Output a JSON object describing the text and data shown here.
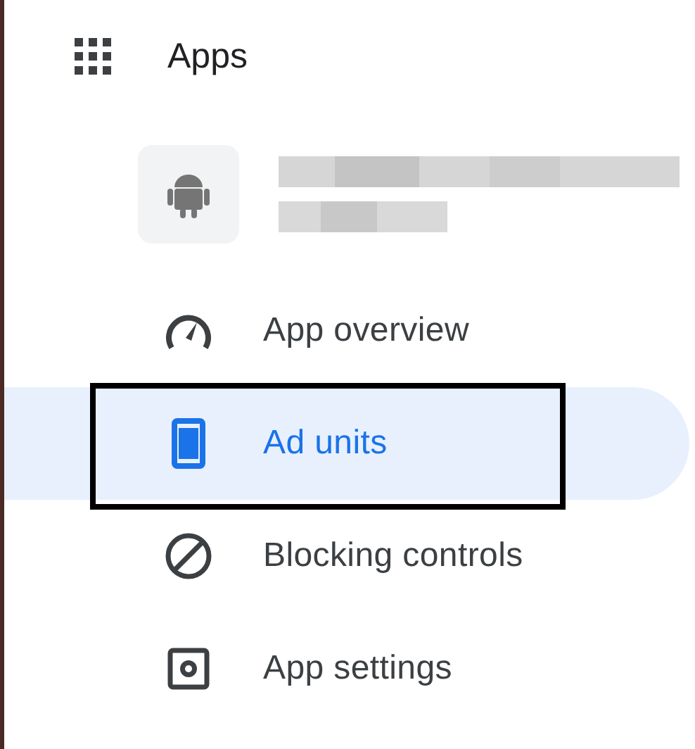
{
  "header": {
    "title": "Apps"
  },
  "app": {
    "name": {
      "kind": "redacted"
    }
  },
  "nav_items": [
    {
      "label": "App overview",
      "kind": "gauge",
      "selected": false,
      "outlined": false
    },
    {
      "label": "Ad units",
      "kind": "phone",
      "selected": true,
      "outlined": true
    },
    {
      "label": "Blocking controls",
      "kind": "block",
      "selected": false,
      "outlined": false
    },
    {
      "label": "App settings",
      "kind": "gear",
      "selected": false,
      "outlined": false
    }
  ]
}
